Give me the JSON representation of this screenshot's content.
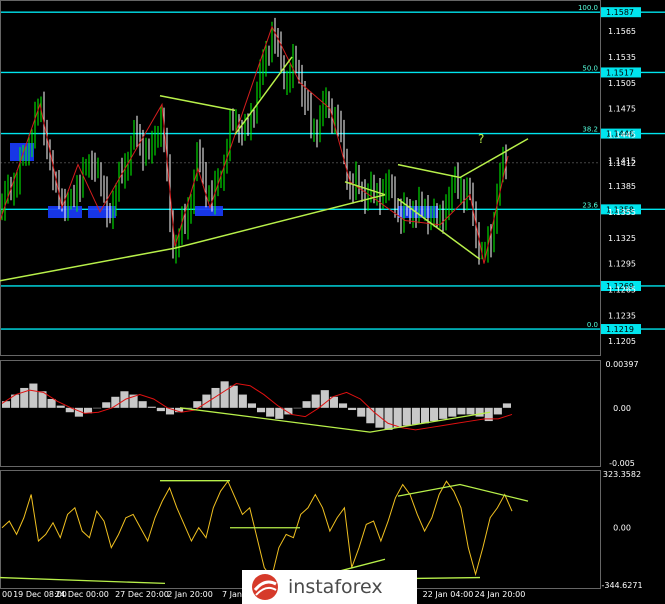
{
  "colors": {
    "background": "#000000",
    "bull_candle": "#00ff00",
    "bear_candle": "#ffffff",
    "fib_line": "#00e5ee",
    "trend_line": "#b8f04a",
    "zigzag": "#d41e1e",
    "support_zone": "#1a3cff",
    "macd_hist": "#c8c8c8",
    "macd_signal": "#e01010",
    "cci_line": "#f0c020",
    "axis_label_bg": "#00e5ee"
  },
  "brand": {
    "name": "instaforex",
    "icon": "instaforex-logo-icon"
  },
  "chart_data": [
    {
      "panel": "price",
      "type": "candlestick",
      "title": "",
      "ylim": [
        1.119,
        1.16
      ],
      "y_ticks": [
        "1.1565",
        "1.1535",
        "1.1505",
        "1.1475",
        "1.1445",
        "1.1415",
        "1.1385",
        "1.1355",
        "1.1325",
        "1.1295",
        "1.1265",
        "1.1235",
        "1.1205"
      ],
      "levels": [
        {
          "value": 1.1587,
          "label": "1.1587",
          "fib": "100.0"
        },
        {
          "value": 1.1517,
          "label": "1.1517",
          "fib": "50.0"
        },
        {
          "value": 1.1446,
          "label": "1.1446",
          "fib": "38.2"
        },
        {
          "value": 1.1358,
          "label": "1.1358",
          "fib": "23.6"
        },
        {
          "value": 1.1269,
          "label": "1.1269",
          "fib": ""
        },
        {
          "value": 1.1219,
          "label": "1.1219",
          "fib": "0.0"
        }
      ],
      "current_price": {
        "value": 1.1412,
        "label": "1.1412"
      },
      "close_path": [
        [
          0,
          1.136
        ],
        [
          12,
          1.1385
        ],
        [
          25,
          1.142
        ],
        [
          40,
          1.148
        ],
        [
          55,
          1.138
        ],
        [
          70,
          1.136
        ],
        [
          80,
          1.1395
        ],
        [
          95,
          1.1415
        ],
        [
          108,
          1.135
        ],
        [
          122,
          1.14
        ],
        [
          135,
          1.1445
        ],
        [
          150,
          1.142
        ],
        [
          162,
          1.147
        ],
        [
          172,
          1.1315
        ],
        [
          185,
          1.134
        ],
        [
          198,
          1.142
        ],
        [
          212,
          1.1365
        ],
        [
          225,
          1.142
        ],
        [
          235,
          1.147
        ],
        [
          245,
          1.144
        ],
        [
          258,
          1.15
        ],
        [
          272,
          1.1565
        ],
        [
          285,
          1.151
        ],
        [
          298,
          1.1525
        ],
        [
          312,
          1.1445
        ],
        [
          325,
          1.148
        ],
        [
          338,
          1.146
        ],
        [
          348,
          1.139
        ],
        [
          362,
          1.138
        ],
        [
          375,
          1.1375
        ],
        [
          390,
          1.1385
        ],
        [
          400,
          1.135
        ],
        [
          415,
          1.136
        ],
        [
          428,
          1.1355
        ],
        [
          440,
          1.1345
        ],
        [
          455,
          1.139
        ],
        [
          470,
          1.137
        ],
        [
          482,
          1.13
        ],
        [
          492,
          1.133
        ],
        [
          500,
          1.14
        ],
        [
          508,
          1.1418
        ]
      ],
      "annotations": [
        "?"
      ]
    },
    {
      "panel": "macd",
      "type": "bar",
      "ylim": [
        -0.005,
        0.00397
      ],
      "y_ticks": [
        "0.00397",
        "0.00",
        "-0.005"
      ],
      "histogram": [
        0.0006,
        0.0012,
        0.0018,
        0.0022,
        0.0015,
        0.0008,
        0.0002,
        -0.0004,
        -0.0008,
        -0.0005,
        0.0,
        0.0005,
        0.001,
        0.0015,
        0.0012,
        0.0006,
        0.0001,
        -0.0003,
        -0.0006,
        -0.0004,
        0.0,
        0.0006,
        0.0012,
        0.0018,
        0.0024,
        0.002,
        0.0012,
        0.0004,
        -0.0004,
        -0.0008,
        -0.001,
        -0.0006,
        0.0,
        0.0006,
        0.0012,
        0.0016,
        0.001,
        0.0004,
        -0.0002,
        -0.0008,
        -0.0014,
        -0.0018,
        -0.002,
        -0.0018,
        -0.0016,
        -0.0015,
        -0.0014,
        -0.0012,
        -0.001,
        -0.0008,
        -0.0006,
        -0.0006,
        -0.0008,
        -0.0012,
        -0.0006,
        0.0004
      ],
      "signal": [
        0.0004,
        0.0012,
        0.0016,
        0.0014,
        0.0006,
        0.0,
        -0.0005,
        -0.0004,
        0.0,
        0.0008,
        0.0012,
        0.0008,
        0.0,
        -0.0004,
        -0.0002,
        0.0006,
        0.0014,
        0.0022,
        0.002,
        0.0012,
        0.0002,
        -0.0006,
        -0.0008,
        0.0,
        0.001,
        0.0014,
        0.0008,
        -0.0004,
        -0.0014,
        -0.0018,
        -0.002,
        -0.0018,
        -0.0016,
        -0.0014,
        -0.0012,
        -0.001,
        -0.001,
        -0.0006
      ]
    },
    {
      "panel": "cci",
      "type": "line",
      "ylim": [
        -344.6271,
        323.3582
      ],
      "y_ticks": [
        "323.3582",
        "0.00",
        "-344.6271"
      ],
      "values": [
        0,
        40,
        -40,
        60,
        200,
        -80,
        -40,
        30,
        -60,
        80,
        120,
        -20,
        -60,
        100,
        40,
        -120,
        -40,
        60,
        80,
        0,
        -80,
        60,
        160,
        240,
        120,
        20,
        -80,
        0,
        -60,
        120,
        220,
        280,
        180,
        80,
        120,
        -60,
        -240,
        -300,
        -120,
        -40,
        -60,
        80,
        120,
        200,
        120,
        -20,
        60,
        120,
        -240,
        -120,
        20,
        40,
        -80,
        40,
        180,
        260,
        200,
        80,
        -20,
        60,
        200,
        280,
        220,
        120,
        -120,
        -280,
        -120,
        60,
        120,
        200,
        100
      ],
      "x_ticks": [
        "19 Dec 08:00",
        "24 Dec 00:00",
        "27 Dec 20:00",
        "2 Jan 20:00",
        "7 Jan",
        "22 Jan 04:00",
        "24 Jan 20:00"
      ],
      "x_tick_first": "00"
    }
  ]
}
